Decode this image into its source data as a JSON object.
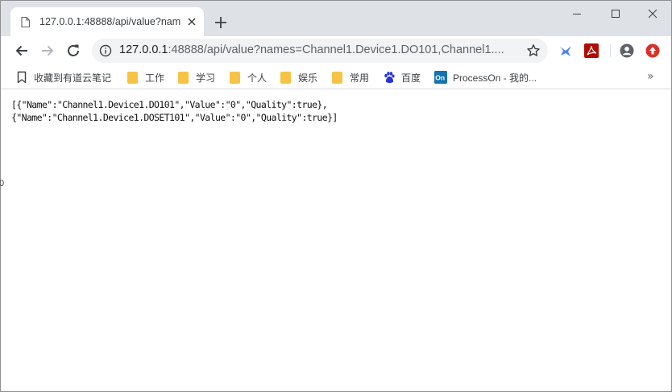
{
  "tab": {
    "title": "127.0.0.1:48888/api/value?nam"
  },
  "omnibox": {
    "host": "127.0.0.1",
    "rest": ":48888/api/value?names=Channel1.Device1.DO101,Channel1...."
  },
  "bookmarks": [
    {
      "label": "收藏到有道云笔记",
      "icon": "bookmark-icon"
    },
    {
      "label": "工作",
      "icon": "folder-icon"
    },
    {
      "label": "学习",
      "icon": "folder-icon"
    },
    {
      "label": "个人",
      "icon": "folder-icon"
    },
    {
      "label": "娱乐",
      "icon": "folder-icon"
    },
    {
      "label": "常用",
      "icon": "folder-icon"
    },
    {
      "label": "百度",
      "icon": "baidu-paw-icon"
    },
    {
      "label": "ProcessOn - 我的...",
      "icon": "processon-icon"
    }
  ],
  "bookmarks_more": "»",
  "page": {
    "line1": "[{\"Name\":\"Channel1.Device1.DO101\",\"Value\":\"0\",\"Quality\":true},",
    "line2": "{\"Name\":\"Channel1.Device1.DOSET101\",\"Value\":\"0\",\"Quality\":true}]",
    "stray_char": "0"
  },
  "colors": {
    "tabstrip": "#dee1e6",
    "folder": "#f6c343",
    "adobe_red": "#b30b00",
    "update_red": "#d93025",
    "baidu_blue": "#2932e1"
  }
}
